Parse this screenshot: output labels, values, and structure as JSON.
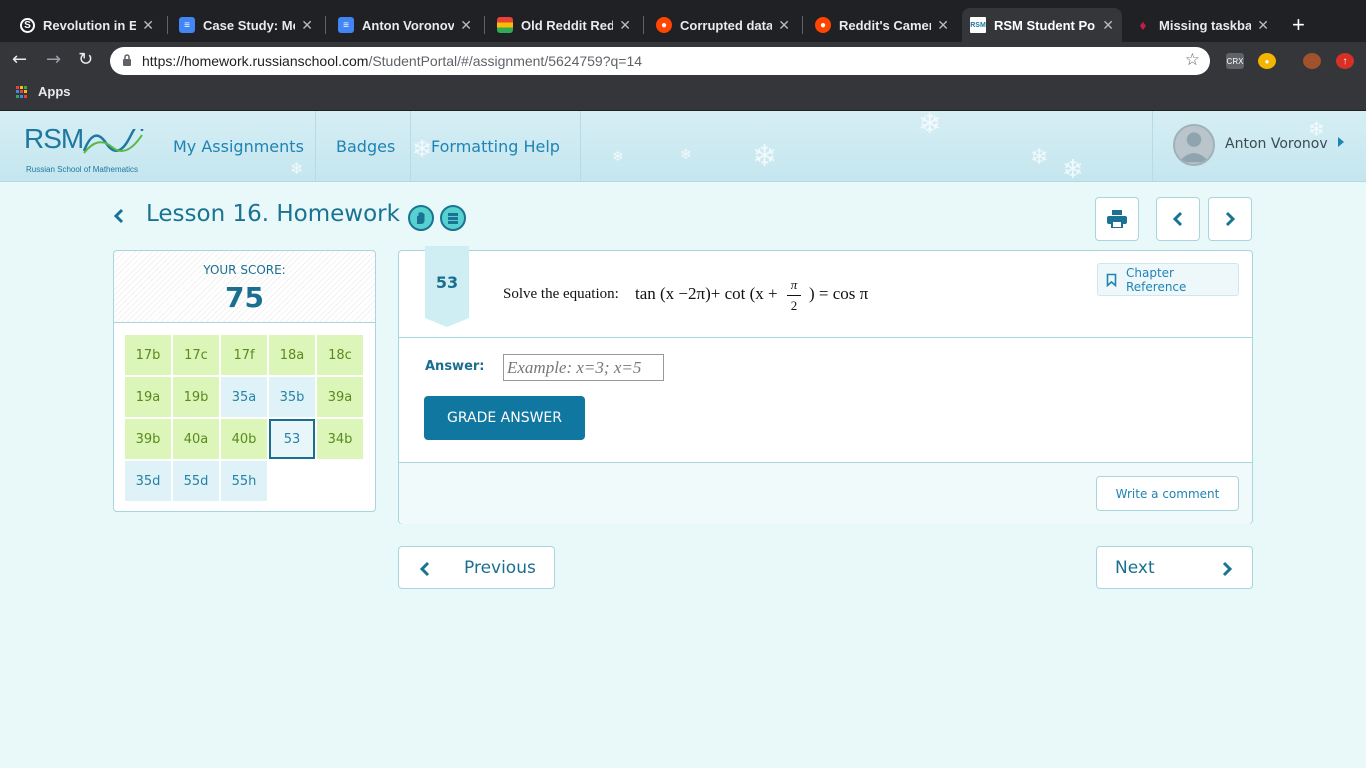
{
  "browser": {
    "tabs": [
      {
        "title": "Revolution in Eur",
        "icon": "circle-s-icon",
        "color": "#ffffff"
      },
      {
        "title": "Case Study: Mex",
        "icon": "docs-icon",
        "color": "#4285f4"
      },
      {
        "title": "Anton Voronov -",
        "icon": "docs-icon",
        "color": "#4285f4"
      },
      {
        "title": "Old Reddit Redir",
        "icon": "chrome-store-icon",
        "color": "#f4b400"
      },
      {
        "title": "Corrupted data v",
        "icon": "reddit-icon",
        "color": "#ff4500"
      },
      {
        "title": "Reddit's Camera",
        "icon": "reddit-icon",
        "color": "#ff4500"
      },
      {
        "title": "RSM Student Po",
        "icon": "rsm-icon",
        "color": "#1e78a0"
      },
      {
        "title": "Missing taskbar",
        "icon": "raspberry-icon",
        "color": "#c51a4a"
      }
    ],
    "active_tab": 6,
    "url_host": "https://homework.russianschool.com",
    "url_path": "/StudentPortal/#/assignment/5624759?q=14",
    "bookmarks_apps_label": "Apps",
    "extension_crx": "CRX"
  },
  "header": {
    "logo_text": "RSM",
    "logo_tagline": "Russian School of Mathematics",
    "nav": [
      "My Assignments",
      "Badges",
      "Formatting Help"
    ],
    "user_name": "Anton Voronov"
  },
  "lesson": {
    "title": "Lesson 16. Homework"
  },
  "score": {
    "label": "YOUR SCORE:",
    "value": "75"
  },
  "problems": [
    {
      "id": "17b",
      "status": "green"
    },
    {
      "id": "17c",
      "status": "green"
    },
    {
      "id": "17f",
      "status": "green"
    },
    {
      "id": "18a",
      "status": "green"
    },
    {
      "id": "18c",
      "status": "green"
    },
    {
      "id": "19a",
      "status": "green"
    },
    {
      "id": "19b",
      "status": "green"
    },
    {
      "id": "35a",
      "status": "blue"
    },
    {
      "id": "35b",
      "status": "blue"
    },
    {
      "id": "39a",
      "status": "green"
    },
    {
      "id": "39b",
      "status": "green"
    },
    {
      "id": "40a",
      "status": "green"
    },
    {
      "id": "40b",
      "status": "green"
    },
    {
      "id": "53",
      "status": "current"
    },
    {
      "id": "34b",
      "status": "green"
    },
    {
      "id": "35d",
      "status": "blue"
    },
    {
      "id": "55d",
      "status": "blue"
    },
    {
      "id": "55h",
      "status": "blue"
    }
  ],
  "question": {
    "number": "53",
    "prompt": "Solve the equation:",
    "eq_part1": "tan (x −2π)+ cot (x +",
    "frac_num": "π",
    "frac_den": "2",
    "eq_part2": ") = cos π",
    "chapter_reference": "Chapter Reference",
    "answer_label": "Answer:",
    "answer_placeholder": "Example: x=3; x=5",
    "answer_value": "",
    "grade_button": "GRADE ANSWER",
    "comment_button": "Write a comment"
  },
  "pager": {
    "previous": "Previous",
    "next": "Next"
  },
  "colors": {
    "brand": "#1a7393",
    "button": "#1077a0",
    "correct": "#dcf5b8",
    "pending": "#dff2f7"
  }
}
